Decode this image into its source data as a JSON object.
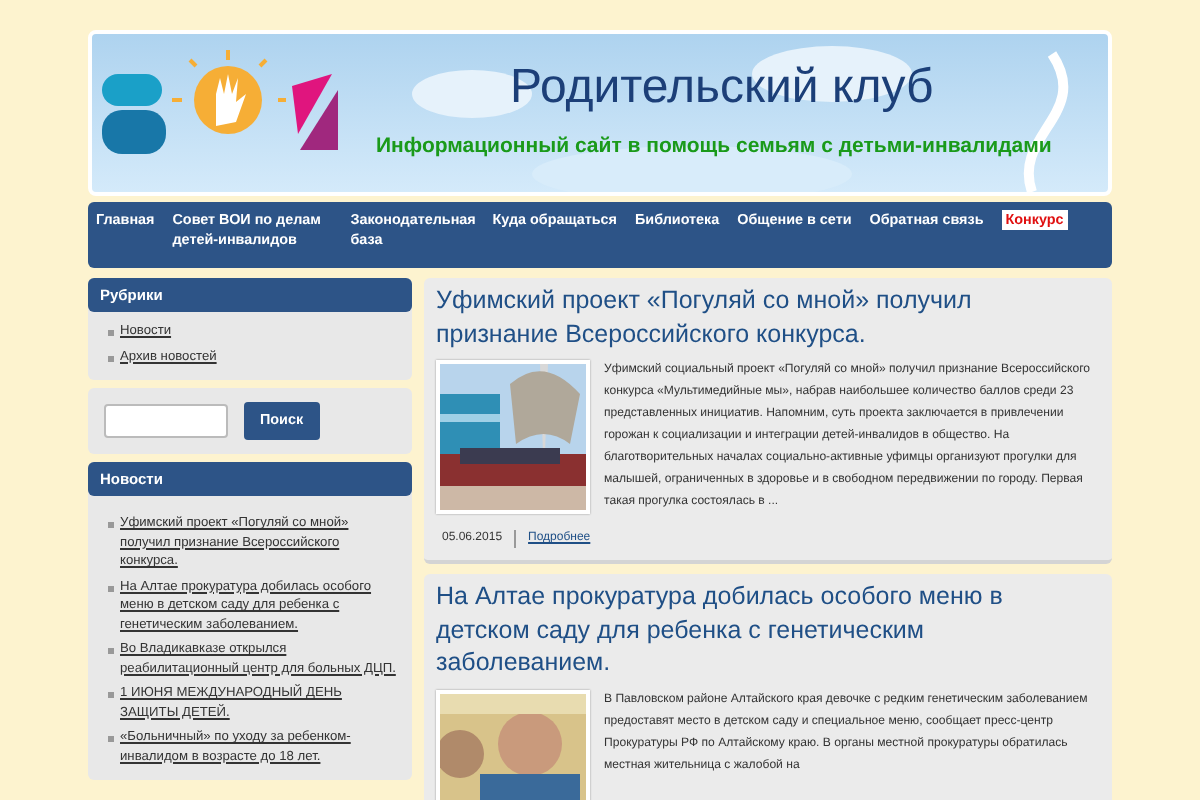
{
  "site": {
    "title": "Родительский клуб",
    "subtitle": "Информационный сайт в помощь семьям с детьми-инвалидами"
  },
  "nav": [
    {
      "label": "Главная",
      "highlighted": false
    },
    {
      "label": "Совет ВОИ по делам детей-инвалидов",
      "highlighted": false
    },
    {
      "label": "Законодательная база",
      "highlighted": false
    },
    {
      "label": "Куда обращаться",
      "highlighted": false
    },
    {
      "label": "Библиотека",
      "highlighted": false
    },
    {
      "label": "Общение в сети",
      "highlighted": false
    },
    {
      "label": "Обратная связь",
      "highlighted": false
    },
    {
      "label": "Конкурс",
      "highlighted": true
    }
  ],
  "sidebar": {
    "rubrics": {
      "title": "Рубрики",
      "items": [
        "Новости",
        "Архив новостей"
      ]
    },
    "search": {
      "button": "Поиск"
    },
    "news": {
      "title": "Новости",
      "items": [
        "Уфимский проект «Погуляй со мной» получил признание Всероссийского конкурса.",
        "На Алтае прокуратура добилась особого меню в детском саду для ребенка с генетическим заболеванием.",
        "Во Владикавказе открылся реабилитационный центр для больных ДЦП.",
        "1 ИЮНЯ МЕЖДУНАРОДНЫЙ ДЕНЬ ЗАЩИТЫ ДЕТЕЙ.",
        "«Больничный» по уходу за ребенком-инвалидом в возрасте до 18 лет."
      ]
    }
  },
  "articles": [
    {
      "title": "Уфимский проект «Погуляй со мной» получил признание Всероссийского конкурса.",
      "text": "Уфимский социальный проект «Погуляй со мной» получил признание Всероссийского конкурса «Мультимедийные мы», набрав наибольшее количество баллов среди 23 представленных инициатив. Напомним, суть проекта заключается в привлечении горожан к социализации и интеграции детей-инвалидов в общество. На благотворительных началах социально-активные уфимцы организуют прогулки для малышей, ограниченных в здоровье и в свободном передвижении по городу. Первая такая прогулка состоялась в ...",
      "date": "05.06.2015",
      "more": "Подробнее"
    },
    {
      "title": "На Алтае прокуратура добилась особого меню в детском саду для ребенка с генетическим заболеванием.",
      "text": "В Павловском районе Алтайского края девочке с редким генетическим заболеванием предоставят место в детском саду и специальное меню, сообщает пресс-центр Прокуратуры РФ по Алтайскому краю. В органы местной прокуратуры обратилась местная жительница с жалобой на"
    }
  ]
}
